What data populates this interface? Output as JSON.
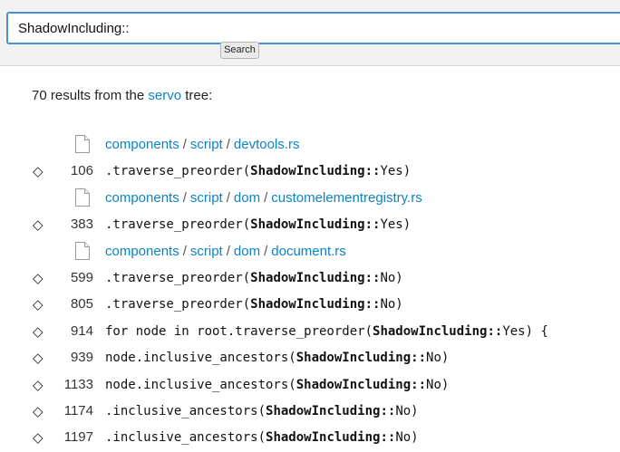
{
  "search": {
    "query": "ShadowIncluding::",
    "button_label": "Search"
  },
  "summary": {
    "count_text": "70 results from the",
    "tree_name": "servo",
    "suffix": "tree:"
  },
  "files": [
    {
      "segments": [
        "components",
        "script",
        "devtools.rs"
      ],
      "lines": [
        {
          "number": "106",
          "pre": ".traverse_preorder(",
          "match": "ShadowIncluding::",
          "post": "Yes)"
        }
      ]
    },
    {
      "segments": [
        "components",
        "script",
        "dom",
        "customelementregistry.rs"
      ],
      "lines": [
        {
          "number": "383",
          "pre": ".traverse_preorder(",
          "match": "ShadowIncluding::",
          "post": "Yes)"
        }
      ]
    },
    {
      "segments": [
        "components",
        "script",
        "dom",
        "document.rs"
      ],
      "lines": [
        {
          "number": "599",
          "pre": ".traverse_preorder(",
          "match": "ShadowIncluding::",
          "post": "No)"
        },
        {
          "number": "805",
          "pre": ".traverse_preorder(",
          "match": "ShadowIncluding::",
          "post": "No)"
        },
        {
          "number": "914",
          "pre": "for node in root.traverse_preorder(",
          "match": "ShadowIncluding::",
          "post": "Yes) {"
        },
        {
          "number": "939",
          "pre": "node.inclusive_ancestors(",
          "match": "ShadowIncluding::",
          "post": "No)"
        },
        {
          "number": "1133",
          "pre": "node.inclusive_ancestors(",
          "match": "ShadowIncluding::",
          "post": "No)"
        },
        {
          "number": "1174",
          "pre": ".inclusive_ancestors(",
          "match": "ShadowIncluding::",
          "post": "No)"
        },
        {
          "number": "1197",
          "pre": ".inclusive_ancestors(",
          "match": "ShadowIncluding::",
          "post": "No)"
        }
      ]
    }
  ],
  "icons": {
    "file": "file-icon",
    "line_marker": "diamond-icon",
    "marker_glyph": "◇"
  },
  "colors": {
    "link": "#0b84c6",
    "search_border": "#4a90d9",
    "topbar": "#f2f2f2"
  }
}
